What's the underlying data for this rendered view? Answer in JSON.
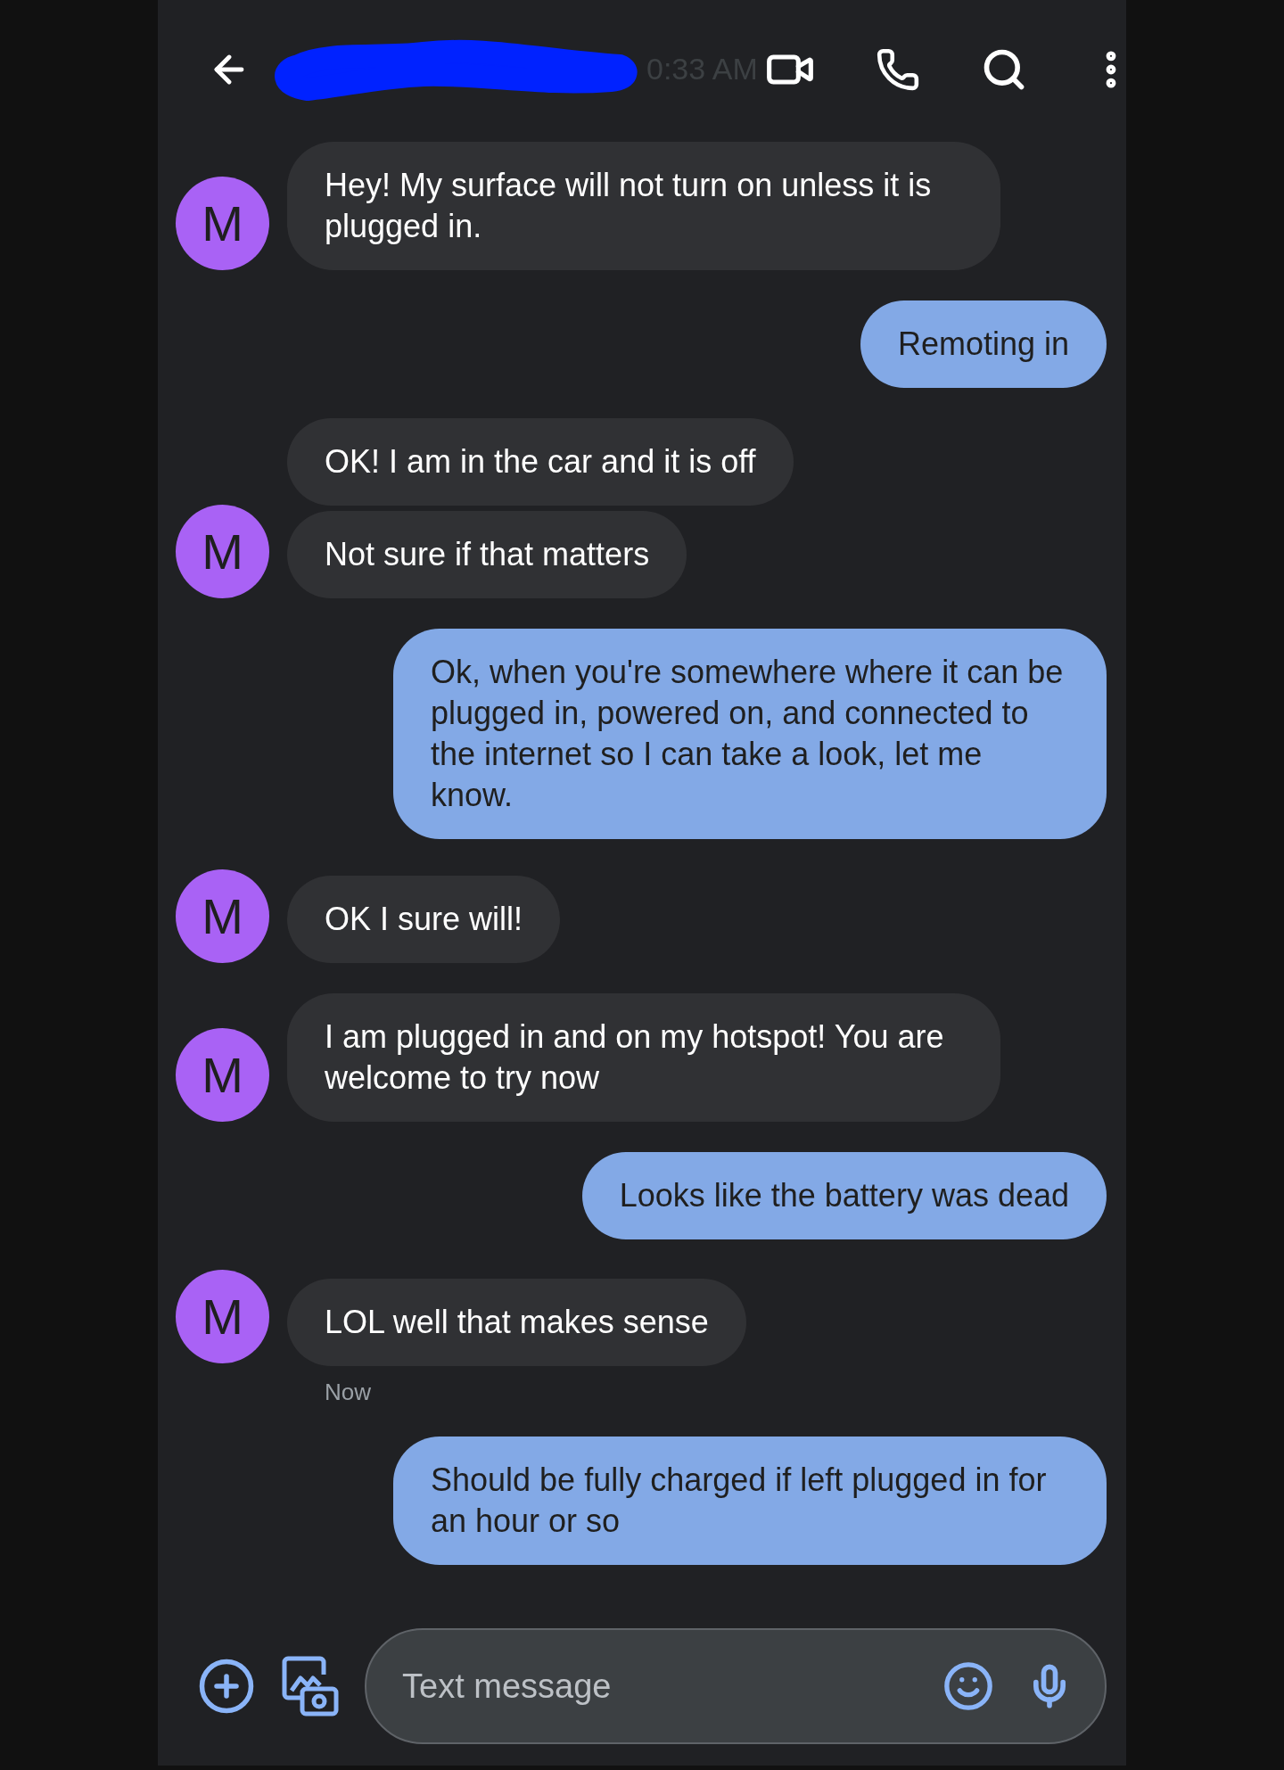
{
  "header": {
    "time": "0:33 AM"
  },
  "messages": [
    {
      "kind": "incoming",
      "avatar": "M",
      "bubbles": [
        "Hey! My surface will not turn on unless it is plugged in."
      ]
    },
    {
      "kind": "outgoing",
      "bubbles": [
        "Remoting in"
      ]
    },
    {
      "kind": "incoming",
      "avatar": "M",
      "bubbles": [
        "OK! I am in the car and it is off",
        "Not sure if that matters"
      ]
    },
    {
      "kind": "outgoing",
      "bubbles": [
        "Ok, when you're somewhere where it can be plugged in, powered on, and connected to the internet so I can take a look, let me know."
      ]
    },
    {
      "kind": "incoming",
      "avatar": "M",
      "bubbles": [
        "OK I sure will!"
      ]
    },
    {
      "kind": "incoming",
      "avatar": "M",
      "bubbles": [
        "I am plugged in and on my hotspot! You are welcome to try now"
      ]
    },
    {
      "kind": "outgoing",
      "bubbles": [
        "Looks like the battery was dead"
      ]
    },
    {
      "kind": "incoming",
      "avatar": "M",
      "bubbles": [
        "LOL well that makes sense"
      ],
      "timestamp": "Now"
    },
    {
      "kind": "outgoing",
      "bubbles": [
        "Should be fully charged if left plugged in for an hour or so"
      ]
    }
  ],
  "composer": {
    "placeholder": "Text message"
  }
}
